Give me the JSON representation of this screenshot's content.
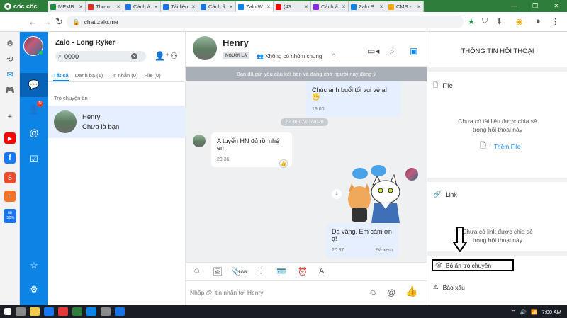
{
  "browser": {
    "brand": "cốc cốc",
    "tabs": [
      {
        "label": "MEMB",
        "color": "#1e8e3e",
        "active": false
      },
      {
        "label": "Thư m",
        "color": "#d93025",
        "active": false
      },
      {
        "label": "Cách ả",
        "color": "#1a73e8",
        "active": false
      },
      {
        "label": "Tài liệu",
        "color": "#1a73e8",
        "active": false
      },
      {
        "label": "Cách ẩ",
        "color": "#1a73e8",
        "active": false
      },
      {
        "label": "Zalo W",
        "color": "#0b84e6",
        "active": true
      },
      {
        "label": "(43",
        "color": "#ff0000",
        "active": false
      },
      {
        "label": "Cách ẩ",
        "color": "#8a2be2",
        "active": false
      },
      {
        "label": "Zalo P",
        "color": "#0b84e6",
        "active": false
      },
      {
        "label": "CMS -",
        "color": "#f2a600",
        "active": false
      }
    ],
    "url": "chat.zalo.me",
    "sidebar_badge": "tải -50%"
  },
  "zalo": {
    "account_title": "Zalo - Long Ryker",
    "search_value": "0000",
    "contacts_badge": "N",
    "list_tabs": [
      "Tất cả",
      "Danh bạ (1)",
      "Tin nhắn (0)",
      "File (0)"
    ],
    "hidden_section": "Trò chuyện ẩn",
    "conversation": {
      "name": "Henry",
      "subtitle": "Chưa là bạn"
    }
  },
  "chat": {
    "name": "Henry",
    "badge": "NGƯỜI LẠ",
    "group_info": "Không có nhóm chung",
    "banner": "Bạn đã gửi yêu cầu kết bạn và đang chờ người này đồng ý",
    "messages": [
      {
        "text": "Chúc anh buổi tối vui vẻ ạ!",
        "emoji": "😁",
        "time": "19:00"
      },
      {
        "text": "A tuyển HN đủ rồi nhé em",
        "time": "20:36"
      },
      {
        "text": "Dạ vâng. Em cảm ơn ạ!",
        "time": "20:37",
        "status": "Đã xem"
      }
    ],
    "date_separator": "20:36 07/07/2020",
    "file_size_label": "1GB",
    "composer_placeholder": "Nhập @, tin nhắn tới Henry"
  },
  "info": {
    "title": "THÔNG TIN HỘI THOẠI",
    "file_label": "File",
    "file_empty": [
      "Chưa có tài liệu được chia sẻ",
      "trong hội thoại này"
    ],
    "add_file": "Thêm File",
    "link_label": "Link",
    "link_empty": [
      "Chưa có link được chia sẻ",
      "trong hội thoại này"
    ],
    "hide_chat": "Bỏ ẩn trò chuyện",
    "report": "Báo xấu"
  },
  "taskbar": {
    "time": "7:00 AM"
  },
  "colors": {
    "zalo_blue": "#0b84e6",
    "browser_green": "#2f7d3a"
  }
}
